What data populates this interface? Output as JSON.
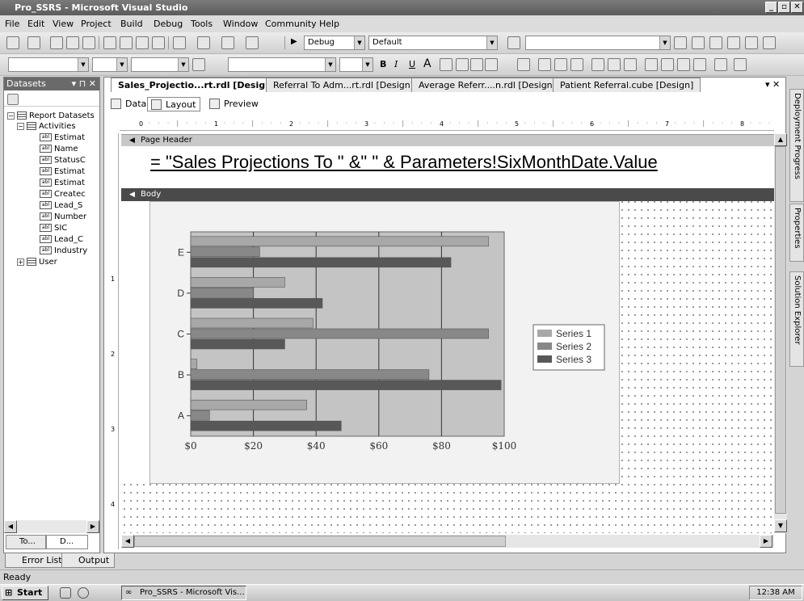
{
  "window": {
    "title": "Pro_SSRS - Microsoft Visual Studio",
    "min": "_",
    "max": "▫",
    "close": "✕"
  },
  "menu": [
    "File",
    "Edit",
    "View",
    "Project",
    "Build",
    "Debug",
    "Tools",
    "Window",
    "Community",
    "Help"
  ],
  "toolbar": {
    "config": "Debug",
    "platform": "Default"
  },
  "datasets_panel": {
    "title": "Datasets",
    "pin": "▾ ⊓ ✕",
    "root": "Report Datasets",
    "dataset": "Activities",
    "fields": [
      "EstimatedAmount",
      "Name",
      "StatusCode",
      "EstimatedStart",
      "EstimatedEnd",
      "CreatedOn",
      "Lead_Source",
      "NumberOf",
      "SIC",
      "Lead_Category",
      "IndustryCode"
    ],
    "fields_visible": [
      "Estimat",
      "Name",
      "StatusC",
      "Estimat",
      "Estimat",
      "Createc",
      "Lead_S",
      "Number",
      "SIC",
      "Lead_C",
      "Industry"
    ],
    "other": "User",
    "tabs": [
      "To...",
      "D..."
    ]
  },
  "doc_tabs": [
    {
      "label": "Sales_Projectio...rt.rdl [Design]*",
      "active": true
    },
    {
      "label": "Referral To Adm...rt.rdl [Design]",
      "active": false
    },
    {
      "label": "Average Referr....n.rdl [Design]",
      "active": false
    },
    {
      "label": "Patient Referral.cube [Design]",
      "active": false
    }
  ],
  "view_tabs": [
    "Data",
    "Layout",
    "Preview"
  ],
  "ruler_marks": [
    "0",
    "1",
    "2",
    "3",
    "4",
    "5",
    "6",
    "7",
    "8"
  ],
  "vruler_marks": [
    "1",
    "2",
    "3",
    "4"
  ],
  "page_header_label": "Page Header",
  "body_label": "Body",
  "expression": "= \"Sales Projections To \" &\" \" & Parameters!SixMonthDate.Value",
  "right_tabs": [
    "Deployment Progress",
    "Properties",
    "Solution Explorer"
  ],
  "bottom_tabs": [
    "Error List",
    "Output"
  ],
  "status": "Ready",
  "taskbar": {
    "start": "Start",
    "task": "Pro_SSRS - Microsoft Vis...",
    "clock": "12:38 AM"
  },
  "chart_data": {
    "type": "bar",
    "orientation": "horizontal",
    "categories": [
      "A",
      "B",
      "C",
      "D",
      "E"
    ],
    "series": [
      {
        "name": "Series 1",
        "values": [
          37,
          2,
          39,
          30,
          95
        ],
        "color": "#a8a8a8"
      },
      {
        "name": "Series 2",
        "values": [
          6,
          76,
          95,
          20,
          22
        ],
        "color": "#888888"
      },
      {
        "name": "Series 3",
        "values": [
          48,
          99,
          30,
          42,
          83
        ],
        "color": "#585858"
      }
    ],
    "xticks": [
      "$0",
      "$20",
      "$40",
      "$60",
      "$80",
      "$100"
    ],
    "xlim": [
      0,
      100
    ],
    "grid": true,
    "legend": "right"
  }
}
